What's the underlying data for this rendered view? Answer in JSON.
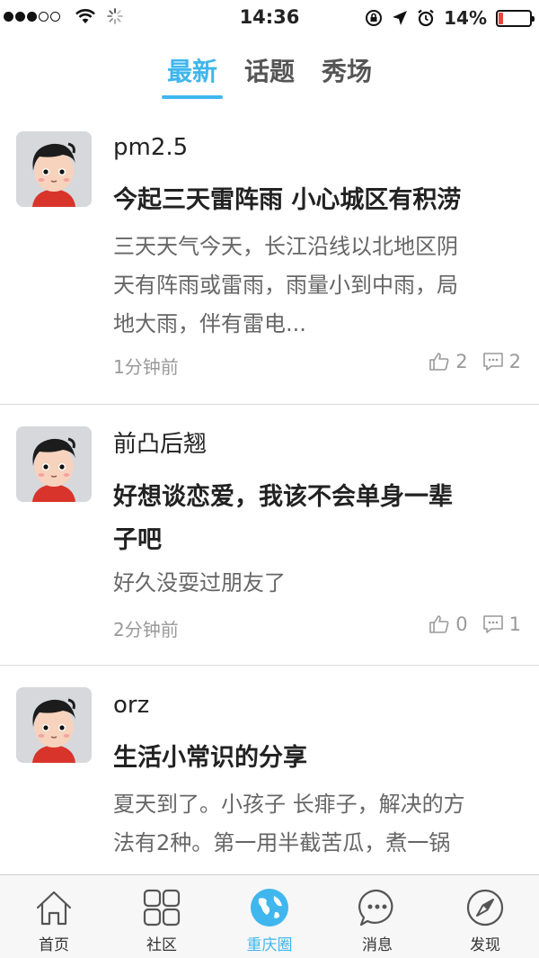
{
  "status_bar": {
    "time": "14:36",
    "battery_percent": "14%",
    "battery_level": 0.14,
    "signal_dots_filled": 3,
    "signal_dots_total": 5
  },
  "tabs": [
    {
      "label": "最新",
      "active": true
    },
    {
      "label": "话题",
      "active": false
    },
    {
      "label": "秀场",
      "active": false
    }
  ],
  "posts": [
    {
      "author": "pm2.5",
      "title": "今起三天雷阵雨 小心城区有积涝",
      "excerpt_lines": [
        "三天天气今天，长江沿线以北地区阴",
        "天有阵雨或雷雨，雨量小到中雨，局",
        "地大雨，伴有雷电..."
      ],
      "time": "1分钟前",
      "likes": "2",
      "comments": "2"
    },
    {
      "author": "前凸后翘",
      "title_lines": [
        "好想谈恋爱，我该不会单身一辈",
        "子吧"
      ],
      "excerpt_lines": [
        "好久没耍过朋友了"
      ],
      "time": "2分钟前",
      "likes": "0",
      "comments": "1"
    },
    {
      "author": "orz",
      "title": "生活小常识的分享",
      "excerpt_lines": [
        "夏天到了。小孩子 长痱子，解决的方",
        "法有2种。第一用半截苦瓜，煮一锅"
      ]
    }
  ],
  "bottom_nav": [
    {
      "label": "首页",
      "icon": "home-icon",
      "active": false
    },
    {
      "label": "社区",
      "icon": "grid-icon",
      "active": false
    },
    {
      "label": "重庆圈",
      "icon": "globe-icon",
      "active": true
    },
    {
      "label": "消息",
      "icon": "message-icon",
      "active": false
    },
    {
      "label": "发现",
      "icon": "compass-icon",
      "active": false
    }
  ],
  "colors": {
    "accent": "#3fb6ee",
    "battery_low": "#e8453c",
    "muted_text": "#999999"
  }
}
